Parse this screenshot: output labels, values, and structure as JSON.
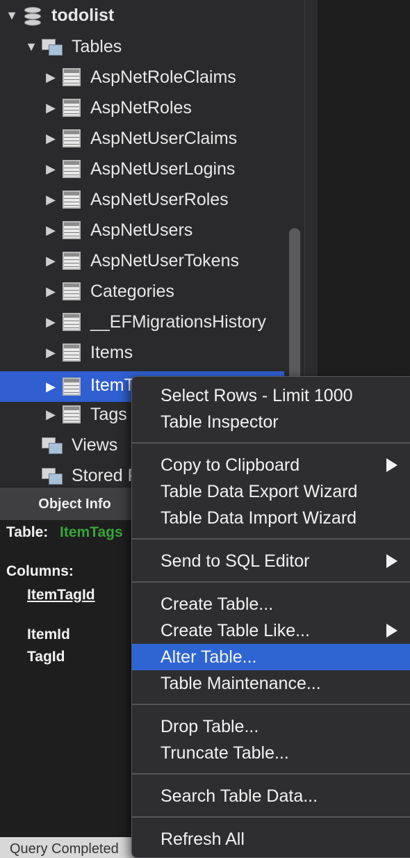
{
  "tree": {
    "database": "todolist",
    "tables_folder": "Tables",
    "tables": [
      "AspNetRoleClaims",
      "AspNetRoles",
      "AspNetUserClaims",
      "AspNetUserLogins",
      "AspNetUserRoles",
      "AspNetUsers",
      "AspNetUserTokens",
      "Categories",
      "__EFMigrationsHistory",
      "Items",
      "ItemTags",
      "Tags"
    ],
    "views_folder": "Views",
    "stored_folder": "Stored Procedures"
  },
  "object_info": {
    "tab_label": "Object Info",
    "table_label": "Table:",
    "table_name": "ItemTags",
    "columns_label": "Columns:",
    "columns": [
      "ItemTagId",
      "ItemId",
      "TagId"
    ]
  },
  "status": "Query Completed",
  "context_menu": {
    "items": [
      "Select Rows - Limit 1000",
      "Table Inspector",
      "Copy to Clipboard",
      "Table Data Export Wizard",
      "Table Data Import Wizard",
      "Send to SQL Editor",
      "Create Table...",
      "Create Table Like...",
      "Alter Table...",
      "Table Maintenance...",
      "Drop Table...",
      "Truncate Table...",
      "Search Table Data...",
      "Refresh All"
    ],
    "highlighted": "Alter Table..."
  },
  "colors": {
    "selection": "#2f5fd0",
    "menu_highlight": "#2f65d2",
    "table_name_green": "#3aa33a"
  }
}
